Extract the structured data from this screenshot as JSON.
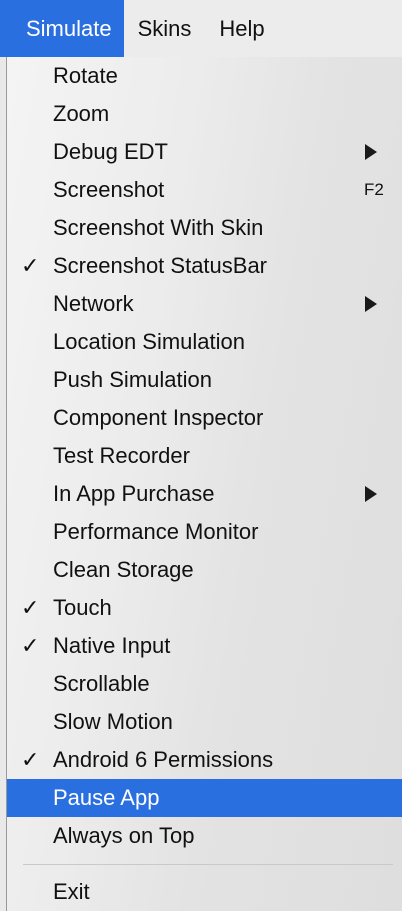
{
  "menubar": {
    "menus": [
      "Simulate",
      "Skins",
      "Help"
    ]
  },
  "dropdown": {
    "items": [
      {
        "label": "Rotate"
      },
      {
        "label": "Zoom"
      },
      {
        "label": "Debug EDT",
        "submenu": true
      },
      {
        "label": "Screenshot",
        "shortcut": "F2"
      },
      {
        "label": "Screenshot With Skin"
      },
      {
        "label": "Screenshot StatusBar",
        "checked": true,
        "check": "✓"
      },
      {
        "label": "Network",
        "submenu": true
      },
      {
        "label": "Location Simulation"
      },
      {
        "label": "Push Simulation"
      },
      {
        "label": "Component Inspector"
      },
      {
        "label": "Test Recorder"
      },
      {
        "label": "In App Purchase",
        "submenu": true
      },
      {
        "label": "Performance Monitor"
      },
      {
        "label": "Clean Storage"
      },
      {
        "label": "Touch",
        "checked": true,
        "check": "✓"
      },
      {
        "label": "Native Input",
        "checked": true,
        "check": "✓"
      },
      {
        "label": "Scrollable"
      },
      {
        "label": "Slow Motion"
      },
      {
        "label": "Android 6 Permissions",
        "checked": true,
        "check": "✓"
      },
      {
        "label": "Pause App",
        "highlighted": true
      },
      {
        "label": "Always on Top"
      },
      {
        "label": "Exit"
      }
    ]
  },
  "colors": {
    "highlight": "#2a6fe0",
    "menubar_bg": "#ececec",
    "text": "#111111"
  }
}
